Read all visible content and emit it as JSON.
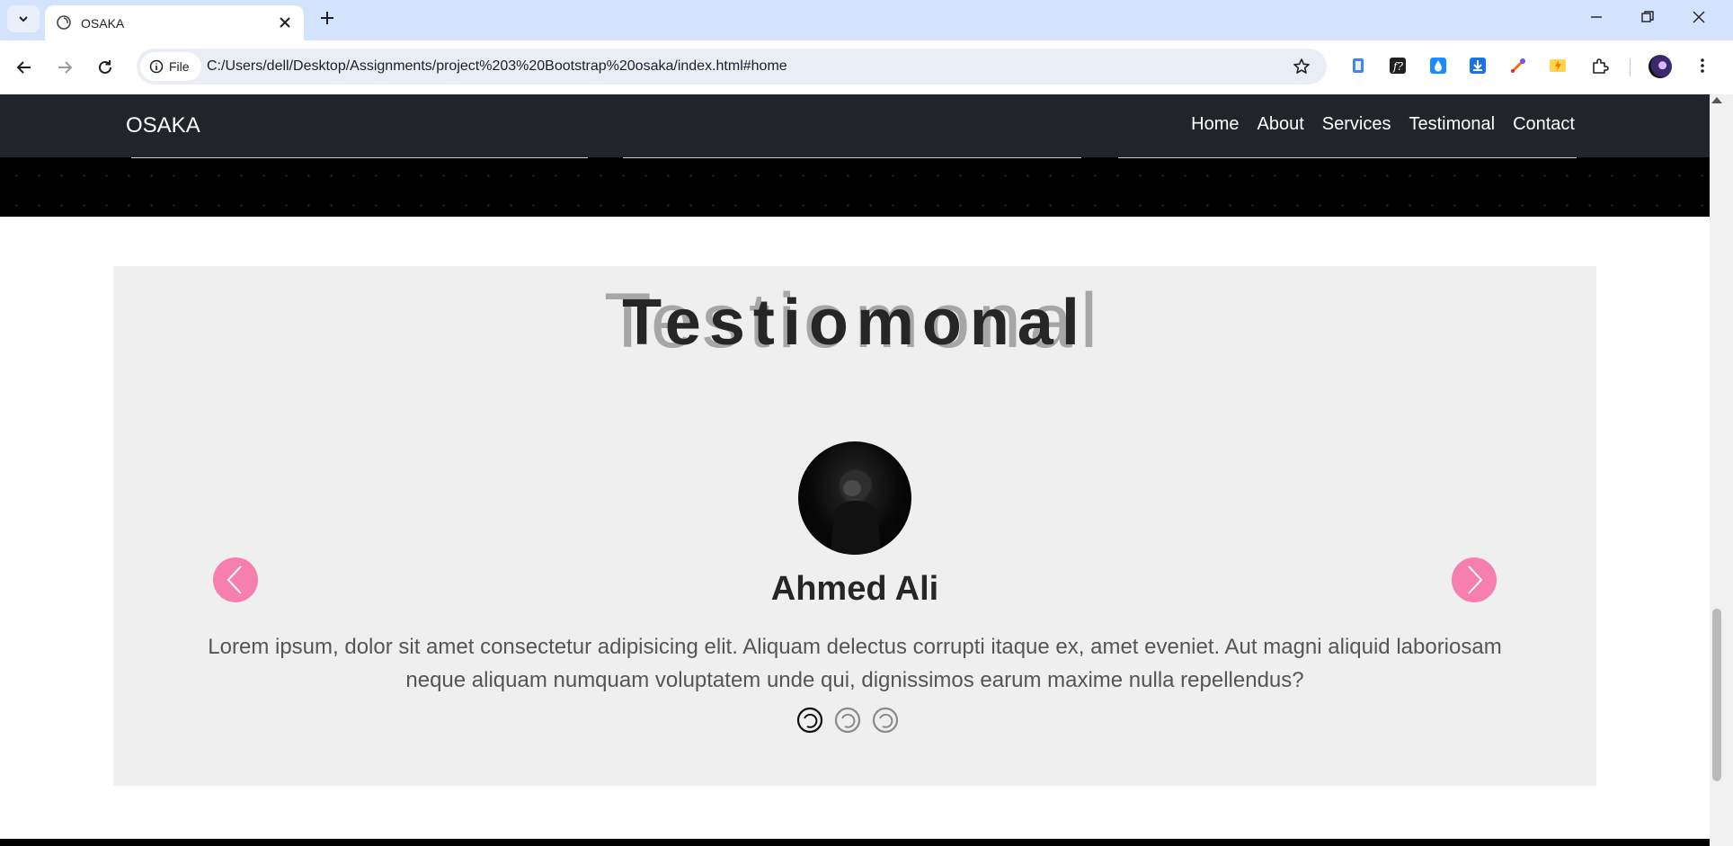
{
  "browser": {
    "tab_title": "OSAKA",
    "address": "C:/Users/dell/Desktop/Assignments/project%203%20Bootstrap%20osaka/index.html#home",
    "site_info_label": "File"
  },
  "navbar": {
    "brand": "OSAKA",
    "links": [
      "Home",
      "About",
      "Services",
      "Testimonal",
      "Contact"
    ]
  },
  "testimonial": {
    "title": "Testiomonal",
    "title_ghost": "Testiomonal",
    "name": "Ahmed Ali",
    "text": "Lorem ipsum, dolor sit amet consectetur adipisicing elit. Aliquam delectus corrupti itaque ex, amet eveniet. Aut magni aliquid laboriosam neque aliquam numquam voluptatem unde qui, dignissimos earum maxime nulla repellendus?",
    "slide_count": 3,
    "active_slide": 1
  },
  "colors": {
    "navbar_bg": "#212529",
    "accent_pink": "#f77fae",
    "section_bg": "#efefef"
  },
  "icons": {
    "prev": "chevron-left-icon",
    "next": "chevron-right-icon"
  }
}
